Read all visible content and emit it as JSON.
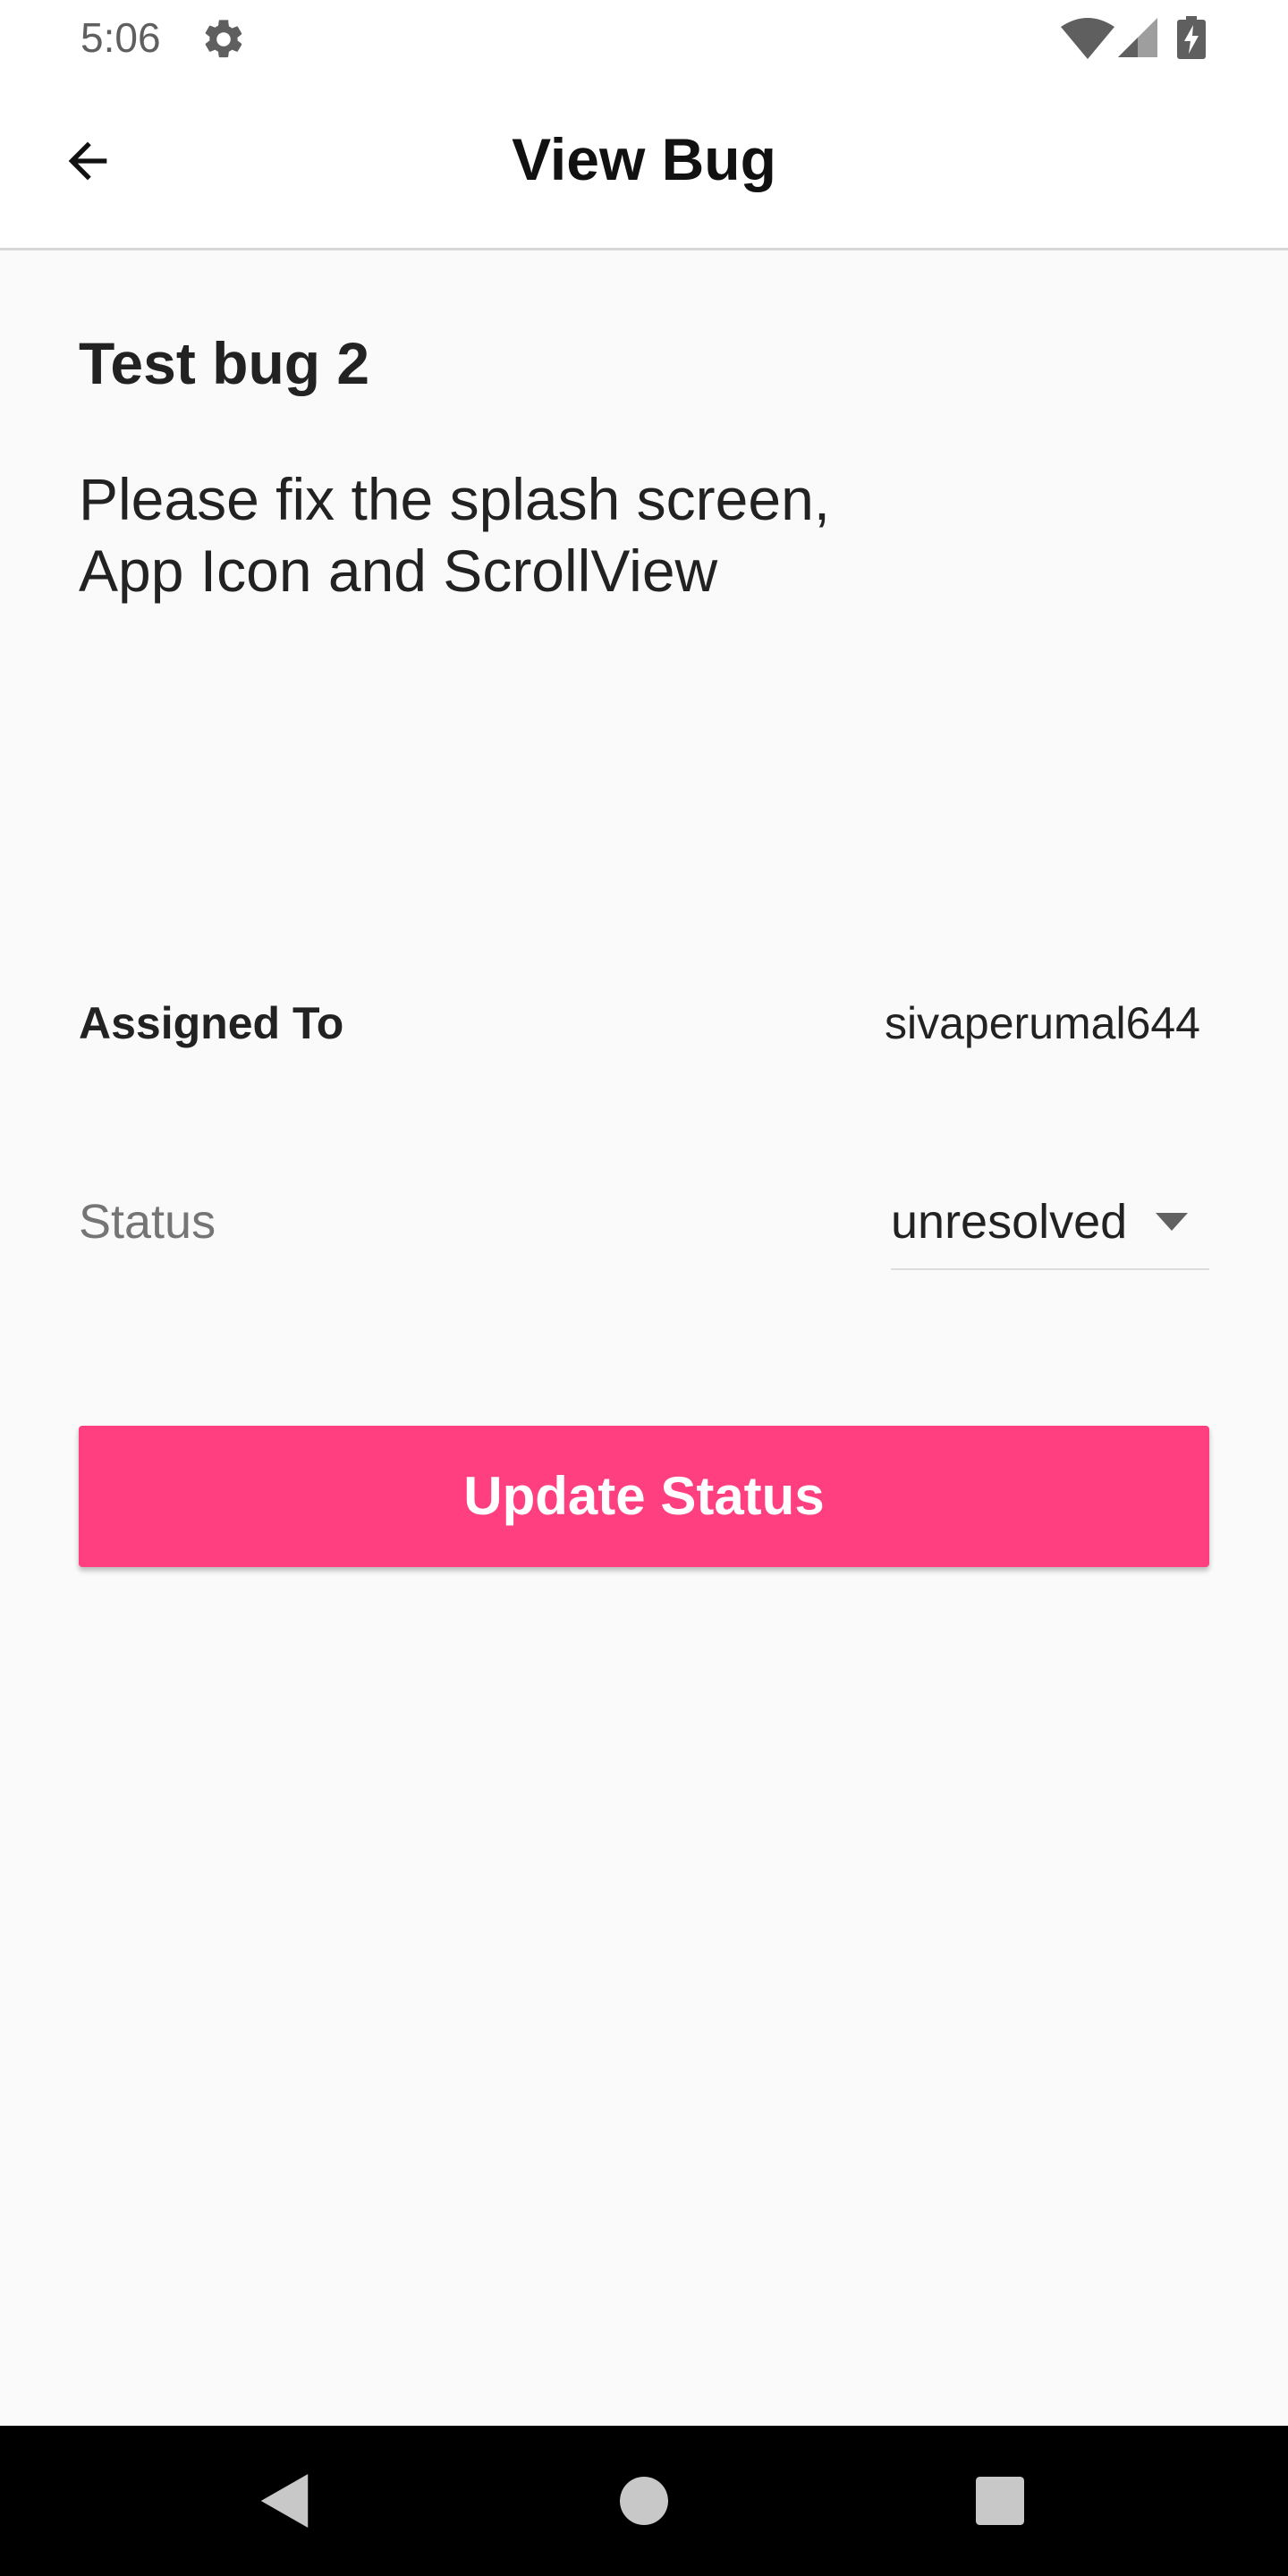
{
  "status_bar": {
    "time": "5:06",
    "icons": [
      "gear-icon",
      "wifi-icon",
      "signal-icon",
      "battery-icon"
    ],
    "icon_color": "#5f5f5f"
  },
  "app_bar": {
    "title": "View Bug",
    "back_icon": "arrow-left-icon"
  },
  "bug": {
    "title": "Test bug 2",
    "description_line1": "Please fix the splash screen,",
    "description_line2": "App Icon and ScrollView",
    "assigned_label": "Assigned To",
    "assigned_value": "sivaperumal644",
    "status_label": "Status",
    "status_value": "unresolved"
  },
  "actions": {
    "update_label": "Update Status",
    "accent_color": "#ff3f7f"
  },
  "nav_bar": {
    "icons": [
      "nav-back-icon",
      "nav-home-icon",
      "nav-recents-icon"
    ]
  }
}
